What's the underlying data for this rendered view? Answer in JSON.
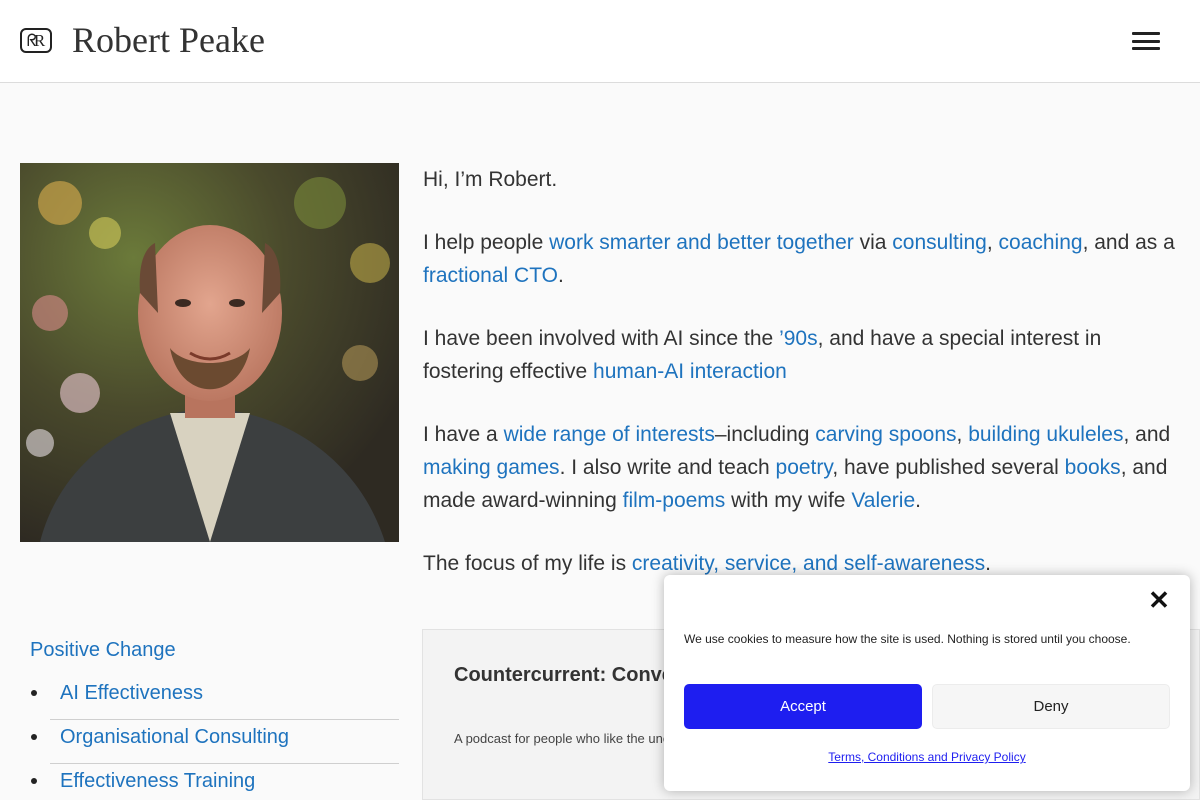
{
  "header": {
    "logo_text": "ᖇR",
    "site_title": "Robert Peake"
  },
  "intro": {
    "greeting": "Hi, I’m Robert.",
    "p2": {
      "t1": "I help people ",
      "l1": "work smarter and better together",
      "t2": " via ",
      "l2": "consulting",
      "t3": ", ",
      "l3": "coaching",
      "t4": ", and as a ",
      "l4": "fractional CTO",
      "t5": "."
    },
    "p3": {
      "t1": "I have been involved with AI since the ",
      "l1": "’90s",
      "t2": ", and have a special interest in fostering effective ",
      "l2": "human-AI interaction"
    },
    "p4": {
      "t1": "I have a ",
      "l1": "wide range of interests",
      "t2": "–including ",
      "l2": "carving spoons",
      "t3": ", ",
      "l3": "building ukuleles",
      "t4": ", and ",
      "l4": "making games",
      "t5": ". I also write and teach ",
      "l5": "poetry",
      "t6": ", have published several ",
      "l6": "books",
      "t7": ", and made award-winning ",
      "l7": "film-poems",
      "t8": " with my wife ",
      "l8": "Valerie",
      "t9": "."
    },
    "p5": {
      "t1": "The focus of my life is ",
      "l1": "creativity, service, and self-awareness",
      "t2": "."
    }
  },
  "sidebar": {
    "heading": "Positive Change",
    "items": [
      {
        "label": "AI Effectiveness"
      },
      {
        "label": "Organisational Consulting"
      },
      {
        "label": "Effectiveness Training"
      }
    ]
  },
  "podcast": {
    "title": "Countercurrent: Conve",
    "desc": "A podcast for people who like the unc conversation with unorthodox people"
  },
  "cookie": {
    "message": "We use cookies to measure how the site is used. Nothing is stored until you choose.",
    "close": "✕",
    "accept": "Accept",
    "deny": "Deny",
    "policy": "Terms, Conditions and Privacy Policy"
  },
  "colors": {
    "link": "#1e73be",
    "accept_button": "#1e1ef0",
    "background": "#fafafa"
  }
}
